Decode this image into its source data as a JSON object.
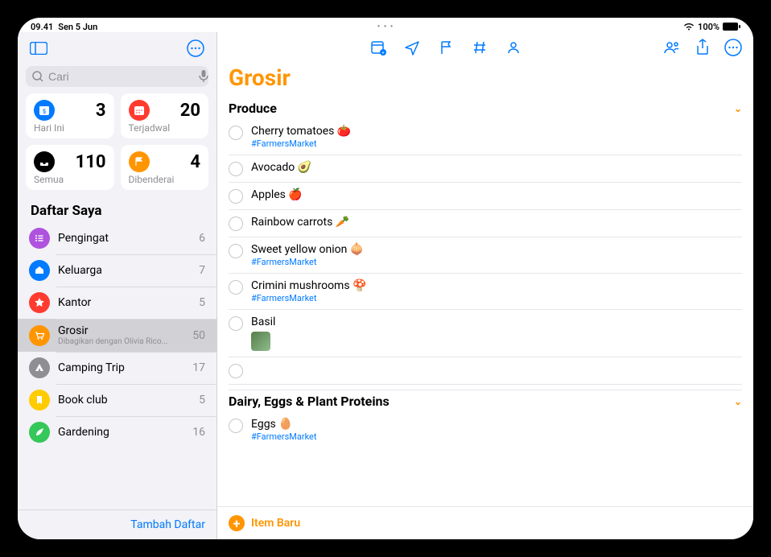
{
  "status": {
    "time": "09.41",
    "date": "Sen 5 Jun",
    "battery": "100%"
  },
  "sidebar": {
    "search_placeholder": "Cari",
    "smart": [
      {
        "label": "Hari Ini",
        "count": "3",
        "color": "#007aff",
        "icon": "calendar-icon"
      },
      {
        "label": "Terjadwal",
        "count": "20",
        "color": "#ff3b30",
        "icon": "calendar-dots-icon"
      },
      {
        "label": "Semua",
        "count": "110",
        "color": "#000000",
        "icon": "tray-icon"
      },
      {
        "label": "Dibenderai",
        "count": "4",
        "color": "#ff9500",
        "icon": "flag-icon"
      }
    ],
    "mylists_label": "Daftar Saya",
    "lists": [
      {
        "name": "Pengingat",
        "count": "6",
        "color": "#af52de",
        "icon": "list-icon"
      },
      {
        "name": "Keluarga",
        "count": "7",
        "color": "#007aff",
        "icon": "house-icon"
      },
      {
        "name": "Kantor",
        "count": "5",
        "color": "#ff3b30",
        "icon": "star-icon"
      },
      {
        "name": "Grosir",
        "sub": "Dibagikan dengan Olivia Rico...",
        "count": "50",
        "color": "#ff9500",
        "icon": "cart-icon",
        "selected": true
      },
      {
        "name": "Camping Trip",
        "count": "17",
        "color": "#8e8e93",
        "icon": "tent-icon"
      },
      {
        "name": "Book club",
        "count": "5",
        "color": "#ffcc00",
        "icon": "bookmark-icon"
      },
      {
        "name": "Gardening",
        "count": "16",
        "color": "#34c759",
        "icon": "leaf-icon"
      }
    ],
    "add_list": "Tambah Daftar"
  },
  "content": {
    "title": "Grosir",
    "sections": [
      {
        "name": "Produce",
        "items": [
          {
            "title": "Cherry tomatoes 🍅",
            "tag": "#FarmersMarket"
          },
          {
            "title": "Avocado 🥑"
          },
          {
            "title": "Apples 🍎"
          },
          {
            "title": "Rainbow carrots 🥕"
          },
          {
            "title": "Sweet yellow onion 🧅",
            "tag": "#FarmersMarket"
          },
          {
            "title": "Crimini mushrooms 🍄",
            "tag": "#FarmersMarket"
          },
          {
            "title": "Basil",
            "image": true
          },
          {
            "title": ""
          }
        ]
      },
      {
        "name": "Dairy, Eggs & Plant Proteins",
        "items": [
          {
            "title": "Eggs 🥚",
            "tag": "#FarmersMarket"
          }
        ]
      }
    ],
    "new_item": "Item Baru"
  }
}
